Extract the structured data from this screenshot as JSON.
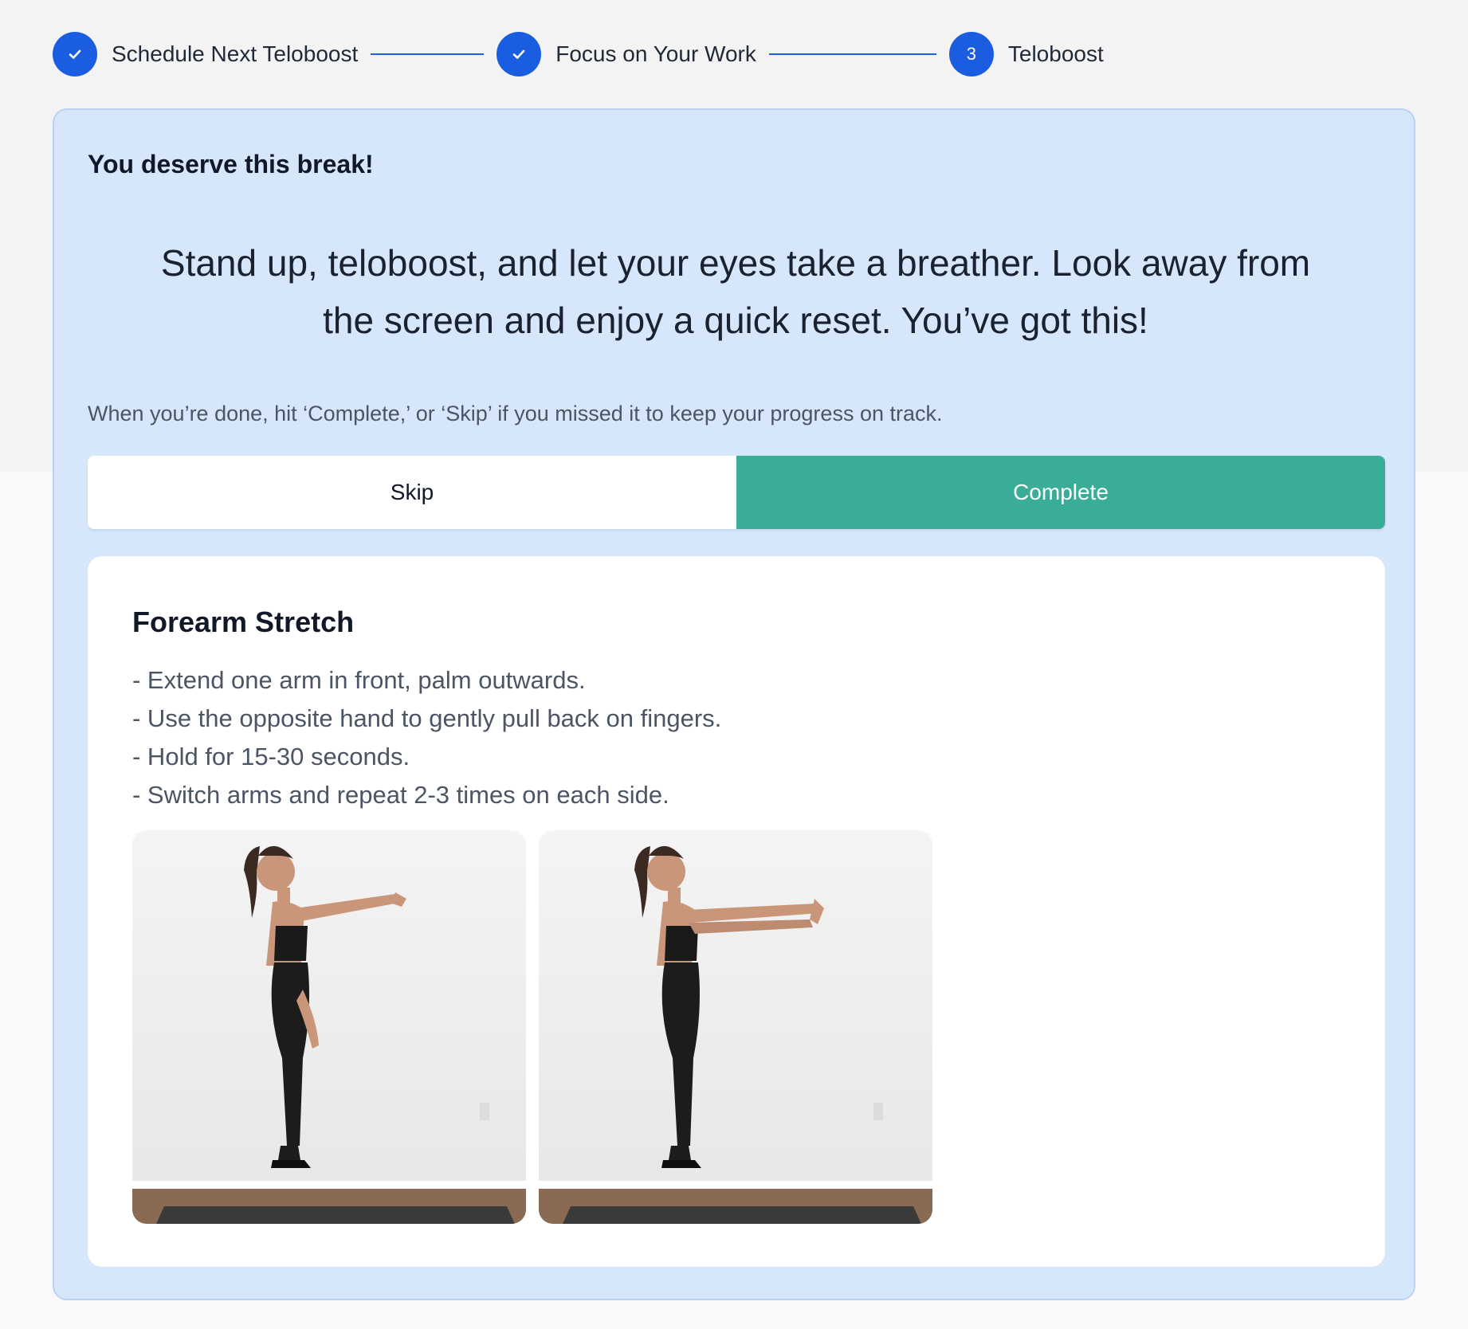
{
  "stepper": {
    "steps": [
      {
        "label": "Schedule Next Teloboost",
        "state": "done",
        "icon": "check-icon"
      },
      {
        "label": "Focus on Your Work",
        "state": "done",
        "icon": "check-icon"
      },
      {
        "label": "Teloboost",
        "state": "current",
        "number": "3"
      }
    ]
  },
  "card": {
    "kicker": "You deserve this break!",
    "headline": "Stand up, teloboost, and let your eyes take a breather. Look away from the screen and enjoy a quick reset. You’ve got this!",
    "instruction": "When you’re done, hit ‘Complete,’ or ‘Skip’ if you missed it to keep your progress on track.",
    "skip_label": "Skip",
    "complete_label": "Complete"
  },
  "exercise": {
    "title": "Forearm Stretch",
    "steps": [
      "- Extend one arm in front, palm outwards.",
      "- Use the opposite hand to gently pull back on fingers.",
      "- Hold for 15-30 seconds.",
      "- Switch arms and repeat 2-3 times on each side."
    ],
    "images": [
      {
        "depicts": "woman standing with one arm extended forward, palm out"
      },
      {
        "depicts": "woman pulling fingers back with opposite hand"
      }
    ]
  },
  "colors": {
    "accent": "#1b5de0",
    "complete": "#3aad99",
    "card_bg": "#d6e6fb"
  }
}
